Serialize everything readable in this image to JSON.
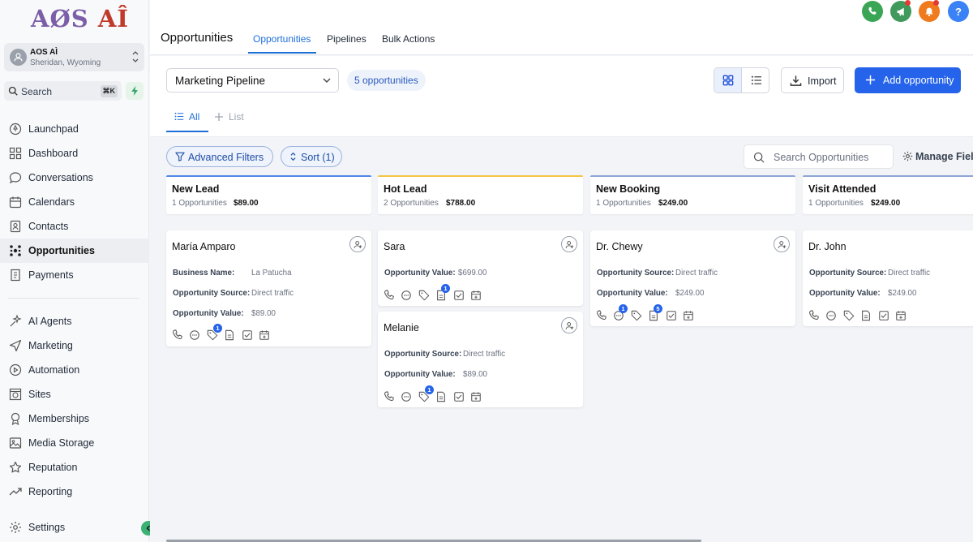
{
  "logo": {
    "part1": "AØS",
    "part2": "AÎ"
  },
  "account": {
    "name": "AOS AÌ",
    "location": "Sheridan, Wyoming"
  },
  "search": {
    "label": "Search",
    "shortcut": "⌘K"
  },
  "nav": {
    "primary": [
      "Launchpad",
      "Dashboard",
      "Conversations",
      "Calendars",
      "Contacts",
      "Opportunities",
      "Payments"
    ],
    "secondary": [
      "AI Agents",
      "Marketing",
      "Automation",
      "Sites",
      "Memberships",
      "Media Storage",
      "Reputation",
      "Reporting"
    ],
    "settings": "Settings",
    "active": "Opportunities"
  },
  "header": {
    "title": "Opportunities",
    "tabs": [
      "Opportunities",
      "Pipelines",
      "Bulk Actions"
    ],
    "active_tab": "Opportunities"
  },
  "toolbar": {
    "pipeline": "Marketing Pipeline",
    "count": "5 opportunities",
    "import_label": "Import",
    "add_label": "Add opportunity"
  },
  "subtabs": {
    "all": "All",
    "list": "List"
  },
  "filters": {
    "advanced": "Advanced Filters",
    "sort": "Sort (1)",
    "search_placeholder": "Search Opportunities",
    "manage": "Manage Fields"
  },
  "columns": [
    {
      "name": "New Lead",
      "count": "1 Opportunities",
      "amount": "$89.00",
      "accent": "#4f86e8"
    },
    {
      "name": "Hot Lead",
      "count": "2 Opportunities",
      "amount": "$788.00",
      "accent": "#f4c542"
    },
    {
      "name": "New Booking",
      "count": "1 Opportunities",
      "amount": "$249.00",
      "accent": "#8da4d6"
    },
    {
      "name": "Visit Attended",
      "count": "1 Opportunities",
      "amount": "$249.00",
      "accent": "#8da4d6"
    }
  ],
  "cards": {
    "maria": {
      "name": "María Amparo",
      "f1k": "Business Name:",
      "f1v": "La Patucha",
      "f2k": "Opportunity Source:",
      "f2v": "Direct traffic",
      "f3k": "Opportunity Value:",
      "f3v": "$89.00",
      "badge": "1"
    },
    "sara": {
      "name": "Sara",
      "f1k": "Opportunity Value:",
      "f1v": "$699.00",
      "badge": "1"
    },
    "melanie": {
      "name": "Melanie",
      "f1k": "Opportunity Source:",
      "f1v": "Direct traffic",
      "f2k": "Opportunity Value:",
      "f2v": "$89.00",
      "badge": "1"
    },
    "chewy": {
      "name": "Dr. Chewy",
      "f1k": "Opportunity Source:",
      "f1v": "Direct traffic",
      "f2k": "Opportunity Value:",
      "f2v": "$249.00",
      "badge1": "1",
      "badge2": "5"
    },
    "john": {
      "name": "Dr. John",
      "f1k": "Opportunity Source:",
      "f1v": "Direct traffic",
      "f2k": "Opportunity Value:",
      "f2v": "$249.00"
    }
  },
  "colors": {
    "primary": "#2563eb",
    "phone": "#3aa655",
    "megaphone": "#3f9a5c",
    "bell": "#f07b1f",
    "help": "#3b82f6"
  }
}
